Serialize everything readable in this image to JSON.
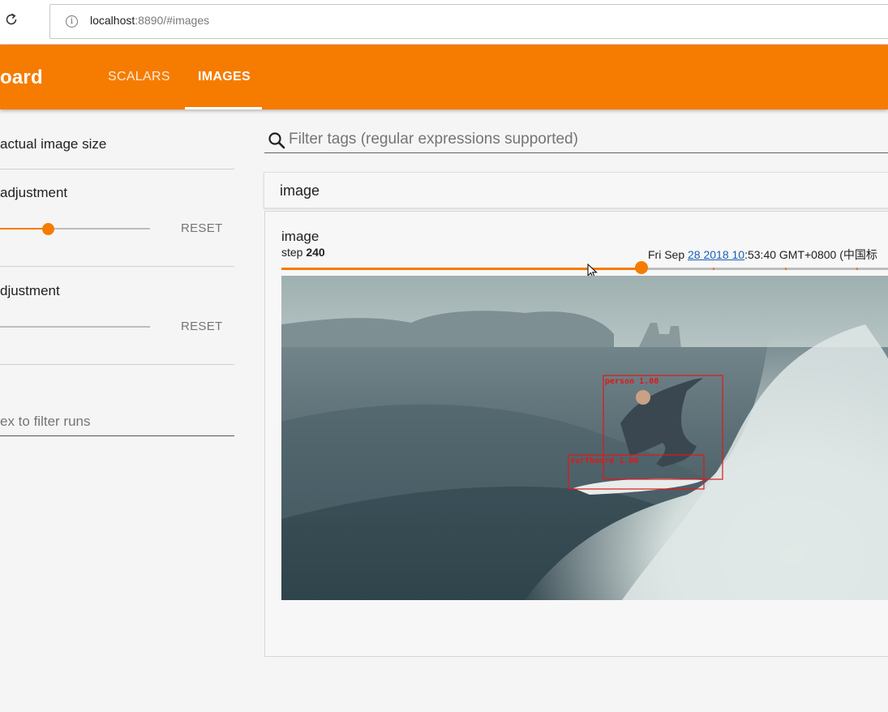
{
  "browser": {
    "url_host": "localhost",
    "url_rest": ":8890/#images",
    "icons": {
      "reload": "reload-icon",
      "info": "info-icon"
    }
  },
  "app": {
    "brand": "oard",
    "tabs": [
      {
        "label": "SCALARS",
        "active": false
      },
      {
        "label": "IMAGES",
        "active": true
      }
    ],
    "accent_color": "#f57c00"
  },
  "sidebar": {
    "actual_size_label": "actual image size",
    "brightness_label": "adjustment",
    "brightness_reset": "RESET",
    "brightness_value": 0.32,
    "contrast_label": "djustment",
    "contrast_reset": "RESET",
    "contrast_value": 0,
    "runs_filter_placeholder": "ex to filter runs"
  },
  "main": {
    "filter_placeholder": "Filter tags (regular expressions supported)",
    "category_title": "image",
    "card": {
      "title": "image",
      "step_label": "step",
      "step_value": "240",
      "timestamp_pre": "Fri Sep ",
      "timestamp_link": "28 2018 10",
      "timestamp_post": ":53:40 GMT+0800 (中国标",
      "step_progress": 0.58,
      "detections": [
        {
          "label": "person 1.00"
        },
        {
          "label": "surfboard 1.00"
        }
      ]
    }
  }
}
